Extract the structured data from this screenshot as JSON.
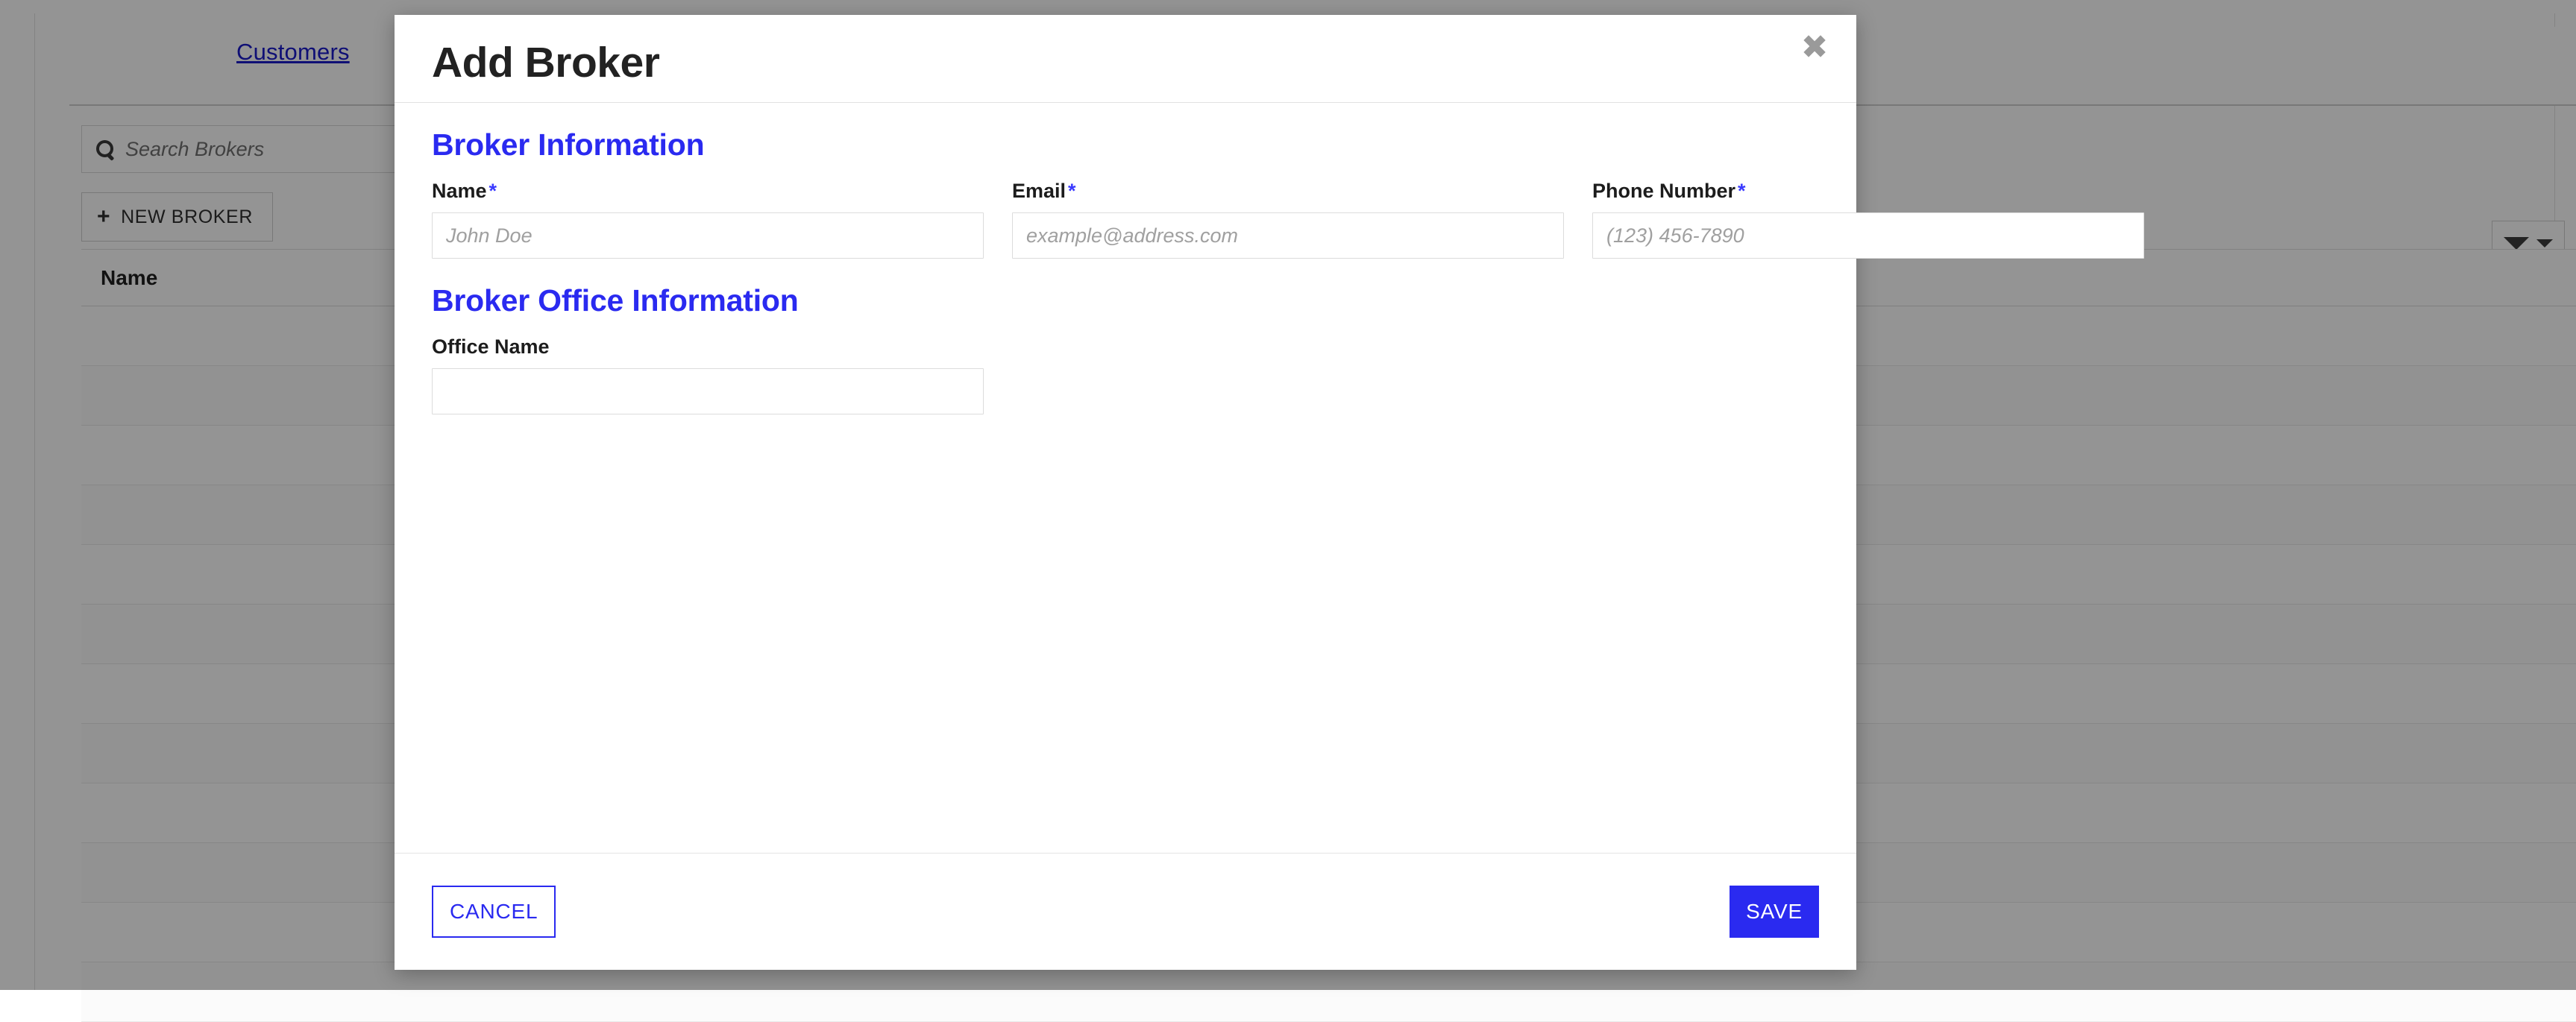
{
  "background": {
    "tab_label": "Customers",
    "search": {
      "placeholder": "Search Brokers",
      "icon": "search-icon"
    },
    "new_broker_button": {
      "icon": "plus-icon",
      "label": "NEW BROKER"
    },
    "filter_button": {
      "icon": "filter-funnel-icon",
      "chevron": "chevron-down-icon"
    },
    "table": {
      "columns": [
        "Name"
      ],
      "rows": [
        [
          ""
        ],
        [
          ""
        ],
        [
          ""
        ],
        [
          ""
        ],
        [
          ""
        ],
        [
          ""
        ],
        [
          ""
        ],
        [
          ""
        ],
        [
          ""
        ],
        [
          ""
        ],
        [
          ""
        ],
        [
          ""
        ]
      ]
    }
  },
  "modal": {
    "title": "Add Broker",
    "close_icon": "close-icon",
    "close_glyph": "✖",
    "sections": [
      {
        "heading": "Broker Information",
        "fields": [
          {
            "label": "Name",
            "required": true,
            "required_mark": "*",
            "placeholder": "John Doe",
            "value": ""
          },
          {
            "label": "Email",
            "required": true,
            "required_mark": "*",
            "placeholder": "example@address.com",
            "value": ""
          },
          {
            "label": "Phone Number",
            "required": true,
            "required_mark": "*",
            "placeholder": "(123) 456-7890",
            "value": ""
          }
        ]
      },
      {
        "heading": "Broker Office Information",
        "fields": [
          {
            "label": "Office Name",
            "required": false,
            "required_mark": "",
            "placeholder": "",
            "value": ""
          }
        ]
      }
    ],
    "footer": {
      "cancel_label": "CANCEL",
      "save_label": "SAVE"
    }
  },
  "colors": {
    "accent_blue": "#2a2af0",
    "link_blue": "#1a1aca",
    "overlay": "rgba(0,0,0,0.42)",
    "text_dark": "#222222",
    "border_gray": "#dcdcdc"
  }
}
